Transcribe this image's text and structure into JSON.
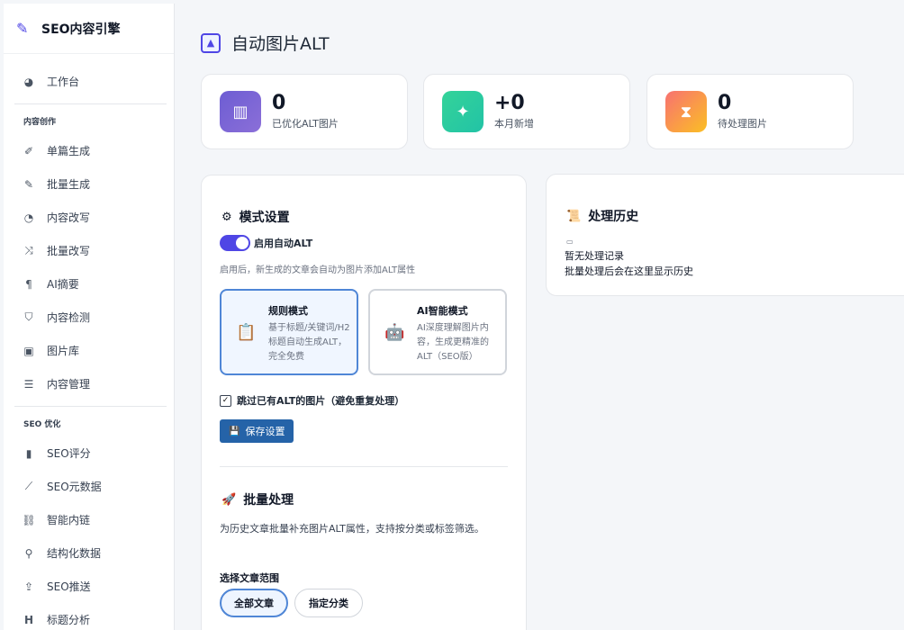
{
  "brand": {
    "title": "SEO内容引擎",
    "icon": "pencil-icon"
  },
  "sidebar": {
    "top_items": [
      {
        "label": "工作台",
        "icon": "dashboard-icon"
      }
    ],
    "sections": [
      {
        "label": "内容创作",
        "items": [
          {
            "label": "单篇生成",
            "icon": "edit-icon"
          },
          {
            "label": "批量生成",
            "icon": "pencil-icon"
          },
          {
            "label": "内容改写",
            "icon": "refresh-icon"
          },
          {
            "label": "批量改写",
            "icon": "shuffle-icon"
          },
          {
            "label": "AI摘要",
            "icon": "paragraph-icon"
          },
          {
            "label": "内容检测",
            "icon": "shield-icon"
          },
          {
            "label": "图片库",
            "icon": "image-icon"
          },
          {
            "label": "内容管理",
            "icon": "table-icon"
          }
        ]
      },
      {
        "label": "SEO 优化",
        "items": [
          {
            "label": "SEO评分",
            "icon": "bar-chart-icon"
          },
          {
            "label": "SEO元数据",
            "icon": "line-chart-icon"
          },
          {
            "label": "智能内链",
            "icon": "link-icon"
          },
          {
            "label": "结构化数据",
            "icon": "search-icon"
          },
          {
            "label": "SEO推送",
            "icon": "share-icon"
          },
          {
            "label": "标题分析",
            "icon": "heading-icon"
          }
        ]
      }
    ]
  },
  "page": {
    "title": "自动图片ALT",
    "icon": "image-icon"
  },
  "stats": [
    {
      "value": "0",
      "label": "已优化ALT图片",
      "icon": "bar-chart-icon",
      "color_from": "#6d5dd3",
      "color_to": "#8b6fd8"
    },
    {
      "value": "+0",
      "label": "本月新增",
      "icon": "sparkle-icon",
      "color_from": "#34d399",
      "color_to": "#22c3a6"
    },
    {
      "value": "0",
      "label": "待处理图片",
      "icon": "hourglass-icon",
      "color_from": "#f87171",
      "color_to": "#fbbf24"
    }
  ],
  "mode_settings": {
    "title": "模式设置",
    "icon": "gear-icon",
    "toggle_label": "启用自动ALT",
    "toggle_on": true,
    "toggle_desc": "启用后，新生成的文章会自动为图片添加ALT属性",
    "modes": [
      {
        "title": "规则模式",
        "desc": "基于标题/关键词/H2标题自动生成ALT，完全免费",
        "icon": "clipboard-icon",
        "selected": true
      },
      {
        "title": "AI智能模式",
        "desc": "AI深度理解图片内容，生成更精准的ALT（SEO版）",
        "icon": "robot-icon",
        "selected": false
      }
    ],
    "skip_label": "跳过已有ALT的图片（避免重复处理）",
    "skip_checked": true,
    "save_label": "保存设置"
  },
  "batch": {
    "title": "批量处理",
    "icon": "rocket-icon",
    "desc": "为历史文章批量补充图片ALT属性，支持按分类或标签筛选。",
    "range_label": "选择文章范围",
    "options": [
      {
        "label": "全部文章",
        "selected": true
      },
      {
        "label": "指定分类",
        "selected": false
      }
    ]
  },
  "history": {
    "title": "处理历史",
    "icon": "scroll-icon",
    "empty_icon": "empty-inbox-icon",
    "empty_text": "暂无处理记录",
    "empty_sub": "批量处理后会在这里显示历史"
  }
}
